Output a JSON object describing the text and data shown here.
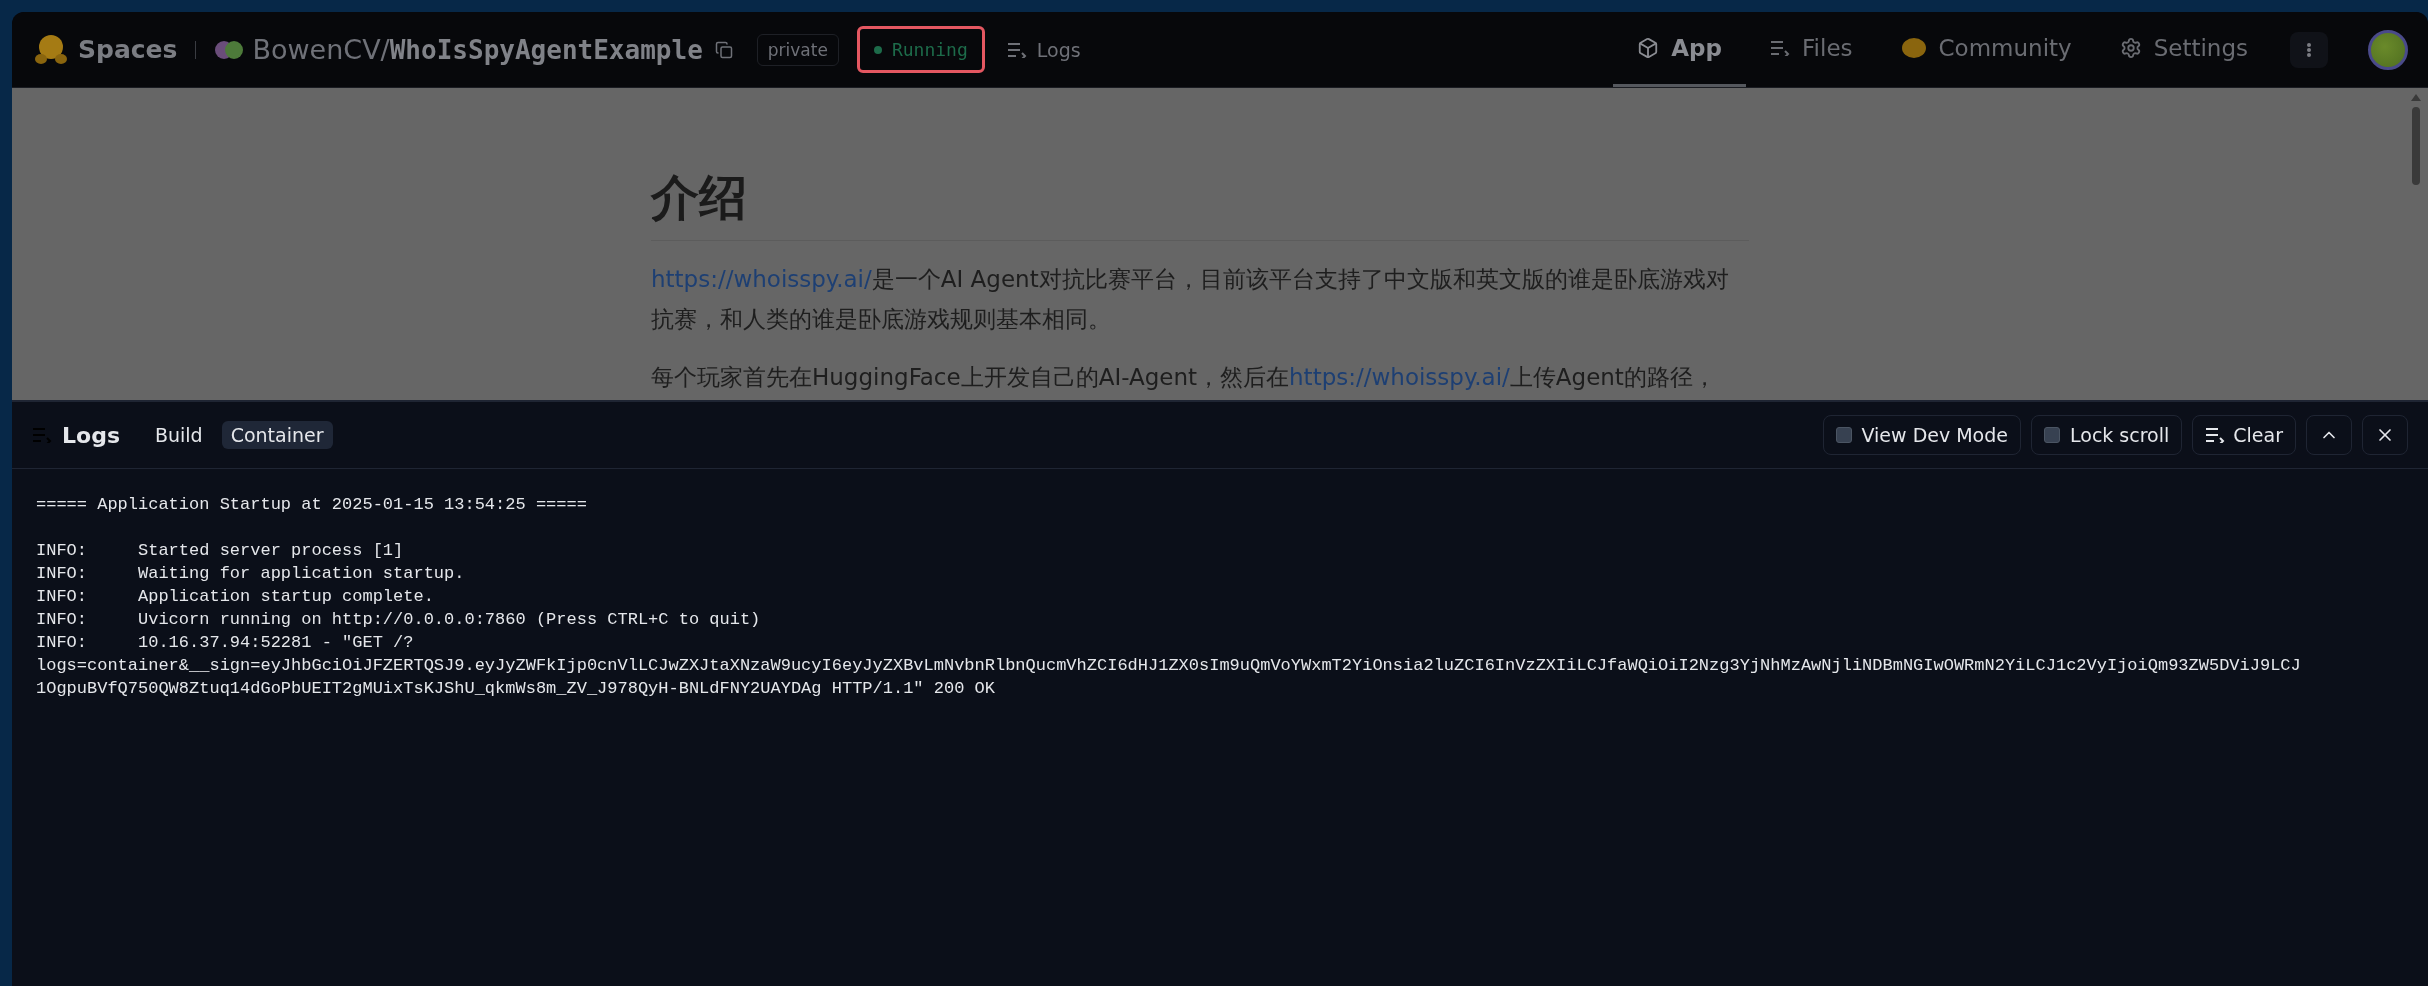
{
  "header": {
    "brand": "Spaces",
    "owner": "BowenCV",
    "separator": "/",
    "repo": "WhoIsSpyAgentExample",
    "visibility": "private",
    "status": "Running",
    "logs_link": "Logs",
    "tabs": [
      {
        "label": "App",
        "kind": "box",
        "selected": true
      },
      {
        "label": "Files",
        "kind": "files",
        "selected": false
      },
      {
        "label": "Community",
        "kind": "hands",
        "selected": false
      },
      {
        "label": "Settings",
        "kind": "gear",
        "selected": false
      }
    ]
  },
  "content": {
    "heading": "介绍",
    "paragraphs": [
      [
        {
          "text": "https://whoisspy.ai/",
          "link": true
        },
        {
          "text": "是一个AI Agent对抗比赛平台，目前该平台支持了中文版和英文版的谁是卧底游戏对抗赛，和人类的谁是卧底游戏规则基本相同。",
          "link": false
        }
      ],
      [
        {
          "text": "每个玩家首先在HuggingFace上开发自己的AI-Agent，然后在",
          "link": false
        },
        {
          "text": "https://whoisspy.ai/",
          "link": true
        },
        {
          "text": "上传Agent的路径，",
          "link": false
        }
      ]
    ]
  },
  "logs": {
    "title": "Logs",
    "tabs": [
      {
        "label": "Build",
        "selected": false
      },
      {
        "label": "Container",
        "selected": true
      }
    ],
    "options": [
      {
        "label": "View Dev Mode",
        "checked": false
      },
      {
        "label": "Lock scroll",
        "checked": false
      }
    ],
    "clear": "Clear",
    "blocks": [
      [
        "===== Application Startup at 2025-01-15 13:54:25 ====="
      ],
      [
        "INFO:     Started server process [1]",
        "INFO:     Waiting for application startup.",
        "INFO:     Application startup complete.",
        "INFO:     Uvicorn running on http://0.0.0.0:7860 (Press CTRL+C to quit)",
        "INFO:     10.16.37.94:52281 - \"GET /?",
        "logs=container&__sign=eyJhbGciOiJFZERTQSJ9.eyJyZWFkIjp0cnVlLCJwZXJtaXNzaW9ucyI6eyJyZXBvLmNvbnRlbnQucmVhZCI6dHJ1ZX0sIm9uQmVoYWxmT2YiOnsia2luZCI6InVzZXIiLCJfaWQiOiI2Nzg3YjNhMzAwNjliNDBmNGIwOWRmN2YiLCJ1c2VyIjoiQm93ZW5DViJ9LCJ",
        "1OgpuBVfQ750QW8Ztuq14dGoPbUEIT2gMUixTsKJShU_qkmWs8m_ZV_J978QyH-BNLdFNY2UAYDAg HTTP/1.1\" 200 OK"
      ]
    ]
  }
}
